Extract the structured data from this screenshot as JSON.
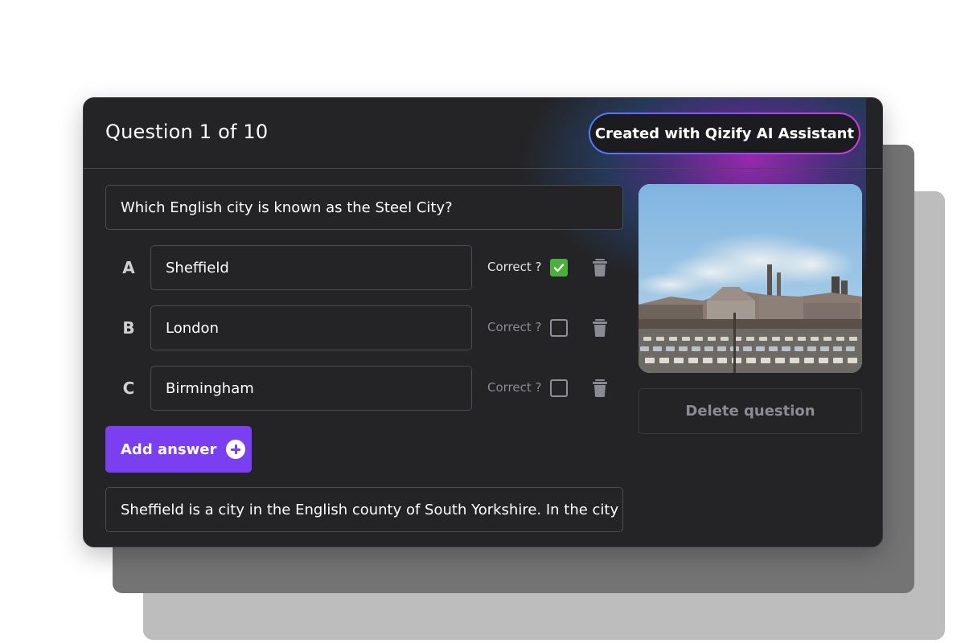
{
  "header": {
    "title": "Question 1 of 10",
    "badge": "Created with Qizify AI Assistant"
  },
  "question": {
    "text": "Which English city is known as the Steel City?"
  },
  "answers": [
    {
      "letter": "A",
      "text": "Sheffield",
      "correct_label": "Correct ?",
      "correct": true
    },
    {
      "letter": "B",
      "text": "London",
      "correct_label": "Correct ?",
      "correct": false
    },
    {
      "letter": "C",
      "text": "Birmingham",
      "correct_label": "Correct ?",
      "correct": false
    }
  ],
  "add_answer_label": "Add answer",
  "explanation": "Sheffield is a city in the English county of South Yorkshire. In the city ce",
  "image": {
    "subject": "industrial-steelworks-photo"
  },
  "delete_question_label": "Delete question",
  "colors": {
    "card_bg": "#242426",
    "accent_purple": "#7b3ff2",
    "check_green": "#4cae3d",
    "badge_gradient_start": "#4f7cff",
    "badge_gradient_end": "#d13bdc"
  }
}
